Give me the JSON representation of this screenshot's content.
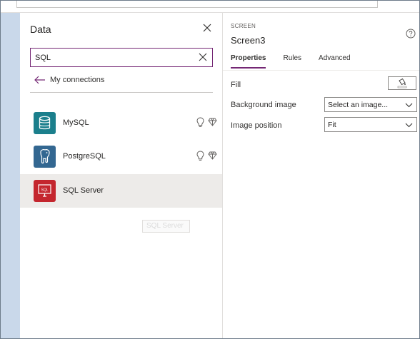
{
  "data_panel": {
    "title": "Data",
    "search": {
      "value": "SQL",
      "placeholder": ""
    },
    "back_link_label": "My connections",
    "connectors": [
      {
        "label": "MySQL",
        "icon": "mysql-database-icon",
        "color": "#1b7f8c",
        "badges": [
          "lightbulb-icon",
          "premium-diamond-icon"
        ]
      },
      {
        "label": "PostgreSQL",
        "icon": "postgresql-elephant-icon",
        "color": "#336791",
        "badges": [
          "lightbulb-icon",
          "premium-diamond-icon"
        ]
      },
      {
        "label": "SQL Server",
        "icon": "sql-server-icon",
        "color": "#c4262e",
        "badges": []
      }
    ],
    "tooltip_text": "SQL Server"
  },
  "properties_panel": {
    "caption": "SCREEN",
    "screen_name": "Screen3",
    "tabs": [
      {
        "label": "Properties",
        "active": true
      },
      {
        "label": "Rules",
        "active": false
      },
      {
        "label": "Advanced",
        "active": false
      }
    ],
    "fill_label": "Fill",
    "background_image_label": "Background image",
    "background_image_value": "Select an image...",
    "image_position_label": "Image position",
    "image_position_value": "Fit"
  },
  "colors": {
    "accent": "#742774",
    "selected_row": "#edebe9",
    "backdrop": "#c9d8ea"
  }
}
